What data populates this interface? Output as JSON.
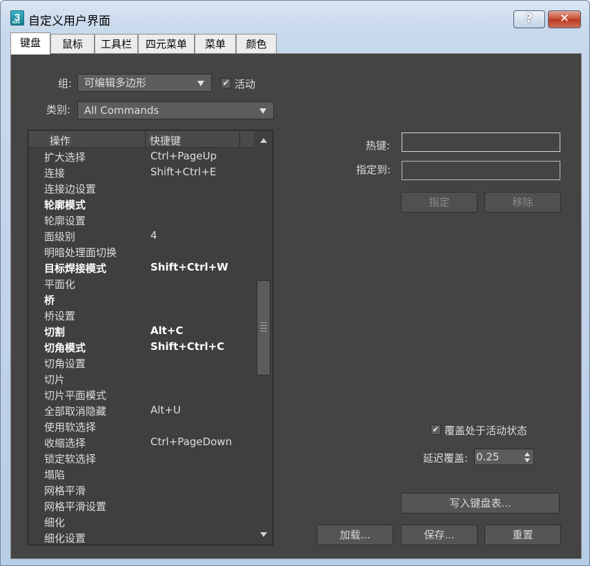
{
  "window": {
    "title": "自定义用户界面",
    "help_label": "?",
    "close_label": "✕",
    "icon_text": "3"
  },
  "tabs": [
    {
      "label": "键盘"
    },
    {
      "label": "鼠标"
    },
    {
      "label": "工具栏"
    },
    {
      "label": "四元菜单"
    },
    {
      "label": "菜单"
    },
    {
      "label": "颜色"
    }
  ],
  "group": {
    "label": "组:",
    "value": "可编辑多边形",
    "active_label": "活动",
    "active_checked": true
  },
  "category": {
    "label": "类别:",
    "value": "All Commands"
  },
  "list": {
    "col_action": "操作",
    "col_hotkey": "快捷键",
    "rows": [
      {
        "action": "扩大选择",
        "hotkey": "Ctrl+PageUp",
        "bold": false
      },
      {
        "action": "连接",
        "hotkey": "Shift+Ctrl+E",
        "bold": false
      },
      {
        "action": "连接边设置",
        "hotkey": "",
        "bold": false
      },
      {
        "action": "轮廓模式",
        "hotkey": "",
        "bold": true
      },
      {
        "action": "轮廓设置",
        "hotkey": "",
        "bold": false
      },
      {
        "action": "面级别",
        "hotkey": "4",
        "bold": false
      },
      {
        "action": "明暗处理面切换",
        "hotkey": "",
        "bold": false
      },
      {
        "action": "目标焊接模式",
        "hotkey": "Shift+Ctrl+W",
        "bold": true
      },
      {
        "action": "平面化",
        "hotkey": "",
        "bold": false
      },
      {
        "action": "桥",
        "hotkey": "",
        "bold": true
      },
      {
        "action": "桥设置",
        "hotkey": "",
        "bold": false
      },
      {
        "action": "切割",
        "hotkey": "Alt+C",
        "bold": true
      },
      {
        "action": "切角模式",
        "hotkey": "Shift+Ctrl+C",
        "bold": true
      },
      {
        "action": "切角设置",
        "hotkey": "",
        "bold": false
      },
      {
        "action": "切片",
        "hotkey": "",
        "bold": false
      },
      {
        "action": "切片平面模式",
        "hotkey": "",
        "bold": false
      },
      {
        "action": "全部取消隐藏",
        "hotkey": "Alt+U",
        "bold": false
      },
      {
        "action": "使用软选择",
        "hotkey": "",
        "bold": false
      },
      {
        "action": "收缩选择",
        "hotkey": "Ctrl+PageDown",
        "bold": false
      },
      {
        "action": "锁定软选择",
        "hotkey": "",
        "bold": false
      },
      {
        "action": "塌陷",
        "hotkey": "",
        "bold": false
      },
      {
        "action": "网格平滑",
        "hotkey": "",
        "bold": false
      },
      {
        "action": "网格平滑设置",
        "hotkey": "",
        "bold": false
      },
      {
        "action": "细化",
        "hotkey": "",
        "bold": false
      },
      {
        "action": "细化设置",
        "hotkey": "",
        "bold": false
      }
    ]
  },
  "hotkey": {
    "label": "热键:",
    "value": ""
  },
  "assigned_to": {
    "label": "指定到:",
    "value": ""
  },
  "buttons": {
    "assign": "指定",
    "remove": "移除",
    "write_keyboard_chart": "写入键盘表...",
    "load": "加载...",
    "save": "保存...",
    "reset": "重置"
  },
  "override": {
    "label": "覆盖处于活动状态",
    "checked": true
  },
  "delay": {
    "label": "延迟覆盖:",
    "value": "0.25"
  }
}
